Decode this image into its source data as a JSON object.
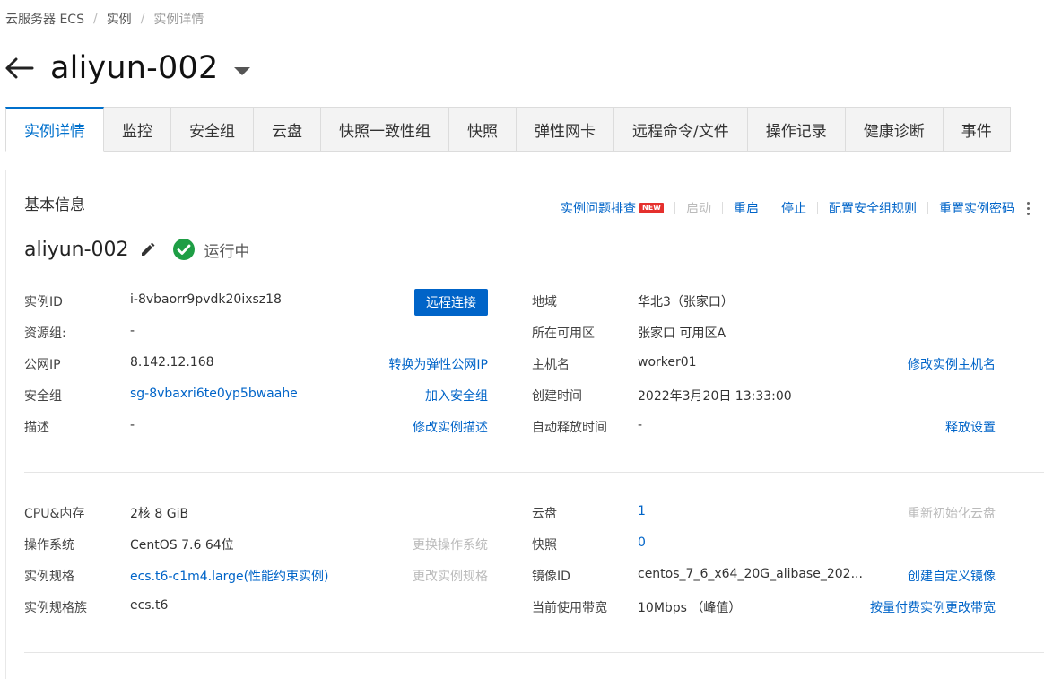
{
  "breadcrumb": {
    "items": [
      "云服务器 ECS",
      "实例"
    ],
    "current": "实例详情",
    "separator": "/"
  },
  "header": {
    "title": "aliyun-002"
  },
  "tabs": [
    "实例详情",
    "监控",
    "安全组",
    "云盘",
    "快照一致性组",
    "快照",
    "弹性网卡",
    "远程命令/文件",
    "操作记录",
    "健康诊断",
    "事件"
  ],
  "basic": {
    "title": "基本信息",
    "actions": {
      "troubleshoot": "实例问题排查",
      "new_badge": "NEW",
      "start": "启动",
      "restart": "重启",
      "stop": "停止",
      "config_sg": "配置安全组规则",
      "reset_pwd": "重置实例密码"
    },
    "instance_name": "aliyun-002",
    "status": "运行中",
    "connect_button": "远程连接",
    "left": [
      {
        "label": "实例ID",
        "value": "i-8vbaorr9pvdk20ixsz18"
      },
      {
        "label": "资源组:",
        "value": "-"
      },
      {
        "label": "公网IP",
        "value": "8.142.12.168",
        "action": "转换为弹性公网IP"
      },
      {
        "label": "安全组",
        "value": "sg-8vbaxri6te0yp5bwaahe",
        "action": "加入安全组"
      },
      {
        "label": "描述",
        "value": "-",
        "action": "修改实例描述"
      }
    ],
    "right": [
      {
        "label": "地域",
        "value": "华北3（张家口）"
      },
      {
        "label": "所在可用区",
        "value": "张家口 可用区A"
      },
      {
        "label": "主机名",
        "value": "worker01",
        "action": "修改实例主机名"
      },
      {
        "label": "创建时间",
        "value": "2022年3月20日 13:33:00"
      },
      {
        "label": "自动释放时间",
        "value": "-",
        "action": "释放设置"
      }
    ]
  },
  "config": {
    "left": [
      {
        "label": "CPU&内存",
        "value": "2核 8 GiB"
      },
      {
        "label": "操作系统",
        "value": "CentOS 7.6 64位",
        "action": "更换操作系统"
      },
      {
        "label": "实例规格",
        "value": "ecs.t6-c1m4.large(性能约束实例)",
        "action": "更改实例规格"
      },
      {
        "label": "实例规格族",
        "value": "ecs.t6"
      }
    ],
    "right": [
      {
        "label": "云盘",
        "value": "1",
        "action": "重新初始化云盘"
      },
      {
        "label": "快照",
        "value": "0"
      },
      {
        "label": "镜像ID",
        "value": "centos_7_6_x64_20G_alibase_202...",
        "action": "创建自定义镜像"
      },
      {
        "label": "当前使用带宽",
        "value": "10Mbps （峰值）",
        "action": "按量付费实例更改带宽"
      }
    ]
  },
  "colors": {
    "accent": "#0064c8",
    "status_ok": "#1e9e45",
    "badge": "#e5302d"
  }
}
